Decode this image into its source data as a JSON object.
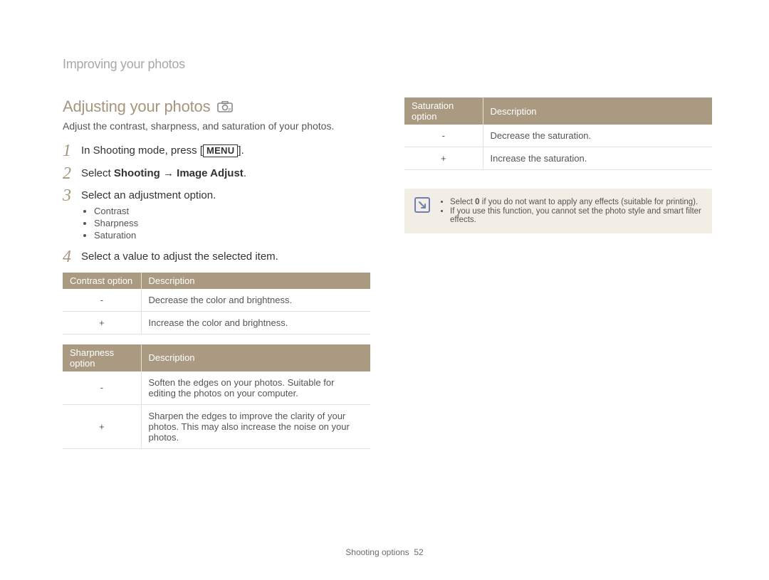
{
  "breadcrumb": "Improving your photos",
  "section_title": "Adjusting your photos",
  "intro": "Adjust the contrast, sharpness, and saturation of your photos.",
  "steps": {
    "s1_pre": "In Shooting mode, press [",
    "s1_menu": "MENU",
    "s1_post": "].",
    "s2_pre": "Select ",
    "s2_bold": "Shooting → Image Adjust",
    "s2_post": ".",
    "s3": "Select an adjustment option.",
    "s3_items": [
      "Contrast",
      "Sharpness",
      "Saturation"
    ],
    "s4": "Select a value to adjust the selected item."
  },
  "tables": {
    "contrast": {
      "headers": [
        "Contrast option",
        "Description"
      ],
      "rows": [
        {
          "opt": "-",
          "desc": "Decrease the color and brightness."
        },
        {
          "opt": "+",
          "desc": "Increase the color and brightness."
        }
      ]
    },
    "sharpness": {
      "headers": [
        "Sharpness option",
        "Description"
      ],
      "rows": [
        {
          "opt": "-",
          "desc": "Soften the edges on your photos. Suitable for editing the photos on your computer."
        },
        {
          "opt": "+",
          "desc": "Sharpen the edges to improve the clarity of your photos. This may also increase the noise on your photos."
        }
      ]
    },
    "saturation": {
      "headers": [
        "Saturation option",
        "Description"
      ],
      "rows": [
        {
          "opt": "-",
          "desc": "Decrease the saturation."
        },
        {
          "opt": "+",
          "desc": "Increase the saturation."
        }
      ]
    }
  },
  "note": {
    "line1_pre": "Select ",
    "line1_bold": "0",
    "line1_post": " if you do not want to apply any effects (suitable for printing).",
    "line2": "If you use this function, you cannot set the photo style and smart filter effects."
  },
  "footer": {
    "label": "Shooting options",
    "page": "52"
  }
}
